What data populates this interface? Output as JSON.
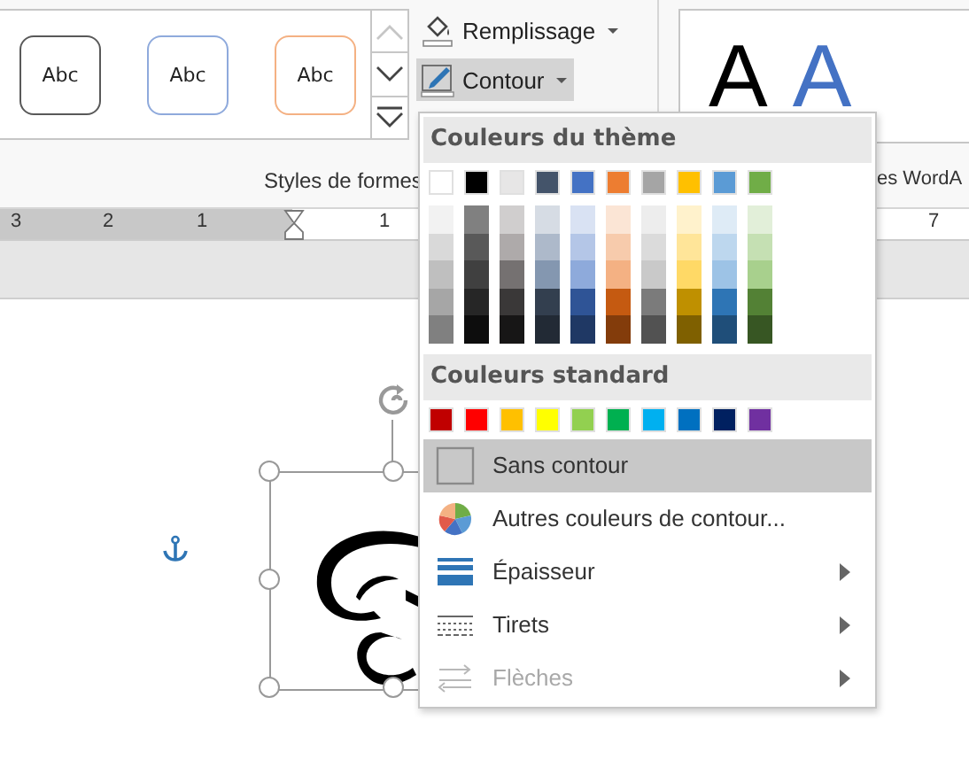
{
  "ribbon": {
    "shape_styles": {
      "samples": [
        {
          "label": "Abc",
          "color": "#595959"
        },
        {
          "label": "Abc",
          "color": "#8faadc"
        },
        {
          "label": "Abc",
          "color": "#f4b183"
        }
      ],
      "group_label": "Styles de formes"
    },
    "fill_button": {
      "label": "Remplissage"
    },
    "outline_button": {
      "label": "Contour",
      "selected": true
    },
    "wordart": {
      "samples": [
        {
          "label": "A",
          "color": "#000000"
        },
        {
          "label": "A",
          "color": "#4472c4"
        }
      ],
      "group_label": "es WordA"
    }
  },
  "ruler": {
    "labels": [
      "3",
      "2",
      "1",
      "1",
      "7"
    ]
  },
  "menu": {
    "theme_header": "Couleurs du thème",
    "theme_colors": [
      {
        "color": "#ffffff",
        "shades": [
          {
            "color": "#f2f2f2"
          },
          {
            "color": "#d9d9d9"
          },
          {
            "color": "#bfbfbf"
          },
          {
            "color": "#a6a6a6"
          },
          {
            "color": "#808080"
          }
        ]
      },
      {
        "color": "#000000",
        "shades": [
          {
            "color": "#808080"
          },
          {
            "color": "#595959"
          },
          {
            "color": "#404040"
          },
          {
            "color": "#262626"
          },
          {
            "color": "#0d0d0d"
          }
        ]
      },
      {
        "color": "#e7e6e6",
        "shades": [
          {
            "color": "#d0cece"
          },
          {
            "color": "#aeaaaa"
          },
          {
            "color": "#757171"
          },
          {
            "color": "#3a3838"
          },
          {
            "color": "#171616"
          }
        ]
      },
      {
        "color": "#44546a",
        "shades": [
          {
            "color": "#d6dce4"
          },
          {
            "color": "#adb9ca"
          },
          {
            "color": "#8497b0"
          },
          {
            "color": "#333f4f"
          },
          {
            "color": "#222a35"
          }
        ]
      },
      {
        "color": "#4472c4",
        "shades": [
          {
            "color": "#d9e2f3"
          },
          {
            "color": "#b4c6e7"
          },
          {
            "color": "#8eaadb"
          },
          {
            "color": "#2f5496"
          },
          {
            "color": "#1f3864"
          }
        ]
      },
      {
        "color": "#ed7d31",
        "shades": [
          {
            "color": "#fbe5d5"
          },
          {
            "color": "#f7cbac"
          },
          {
            "color": "#f4b183"
          },
          {
            "color": "#c55a11"
          },
          {
            "color": "#833c0b"
          }
        ]
      },
      {
        "color": "#a5a5a5",
        "shades": [
          {
            "color": "#ededed"
          },
          {
            "color": "#dbdbdb"
          },
          {
            "color": "#c9c9c9"
          },
          {
            "color": "#7b7b7b"
          },
          {
            "color": "#525252"
          }
        ]
      },
      {
        "color": "#ffc000",
        "shades": [
          {
            "color": "#fff2cc"
          },
          {
            "color": "#ffe599"
          },
          {
            "color": "#ffd966"
          },
          {
            "color": "#bf9000"
          },
          {
            "color": "#7f6000"
          }
        ]
      },
      {
        "color": "#5b9bd5",
        "shades": [
          {
            "color": "#deebf6"
          },
          {
            "color": "#bdd7ee"
          },
          {
            "color": "#9dc3e6"
          },
          {
            "color": "#2e75b5"
          },
          {
            "color": "#1f4e79"
          }
        ]
      },
      {
        "color": "#70ad47",
        "shades": [
          {
            "color": "#e2efd9"
          },
          {
            "color": "#c5e0b3"
          },
          {
            "color": "#a8d08d"
          },
          {
            "color": "#538135"
          },
          {
            "color": "#375623"
          }
        ]
      }
    ],
    "standard_header": "Couleurs standard",
    "standard_colors": [
      {
        "color": "#c00000"
      },
      {
        "color": "#ff0000"
      },
      {
        "color": "#ffc000"
      },
      {
        "color": "#ffff00"
      },
      {
        "color": "#92d050"
      },
      {
        "color": "#00b050"
      },
      {
        "color": "#00b0f0"
      },
      {
        "color": "#0070c0"
      },
      {
        "color": "#002060"
      },
      {
        "color": "#7030a0"
      }
    ],
    "items": [
      {
        "kind": "none",
        "label": "Sans contour",
        "selected": true,
        "disabled": false,
        "submenu": false
      },
      {
        "kind": "wheel",
        "label": "Autres couleurs de contour...",
        "selected": false,
        "disabled": false,
        "submenu": false
      },
      {
        "kind": "weight",
        "label": "Épaisseur",
        "selected": false,
        "disabled": false,
        "submenu": true
      },
      {
        "kind": "dashes",
        "label": "Tirets",
        "selected": false,
        "disabled": false,
        "submenu": true
      },
      {
        "kind": "arrows",
        "label": "Flèches",
        "selected": false,
        "disabled": true,
        "submenu": true
      }
    ]
  }
}
